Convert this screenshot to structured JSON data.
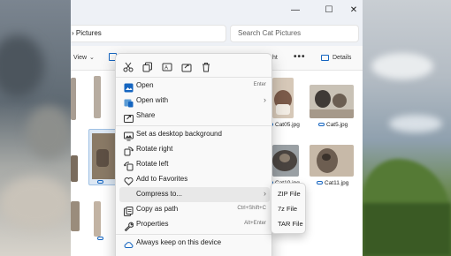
{
  "window": {
    "address_text": "› Pictures",
    "search_placeholder": "Search Cat Pictures",
    "controls": {
      "minimize": "—",
      "maximize": "☐",
      "close": "✕"
    }
  },
  "toolbar": {
    "view_label": "View",
    "view_chevron": "⌄",
    "partial_label": "ht",
    "more_label": "•••",
    "details_label": "Details"
  },
  "files": {
    "labels": [
      "Cat05.jpg",
      "Cat5.jpg",
      "Cat10.jpg",
      "Cat11.jpg"
    ]
  },
  "context_menu": {
    "quick_actions": [
      "cut-icon",
      "copy-icon",
      "rename-icon",
      "share-icon",
      "delete-icon"
    ],
    "items": [
      {
        "label": "Open",
        "shortcut": "Enter"
      },
      {
        "label": "Open with",
        "arrow": "›"
      },
      {
        "label": "Share"
      },
      {
        "label": "Set as desktop background"
      },
      {
        "label": "Rotate right"
      },
      {
        "label": "Rotate left"
      },
      {
        "label": "Add to Favorites"
      },
      {
        "label": "Compress to...",
        "arrow": "›"
      },
      {
        "label": "Copy as path",
        "shortcut": "Ctrl+Shift+C"
      },
      {
        "label": "Properties",
        "shortcut": "Alt+Enter"
      },
      {
        "label": "Always keep on this device"
      }
    ],
    "submenu": [
      "ZIP File",
      "7z File",
      "TAR File"
    ]
  },
  "colors": {
    "accent": "#1565c0",
    "menu_background": "#f9f9f9",
    "hover_background": "#e8e8e8"
  }
}
